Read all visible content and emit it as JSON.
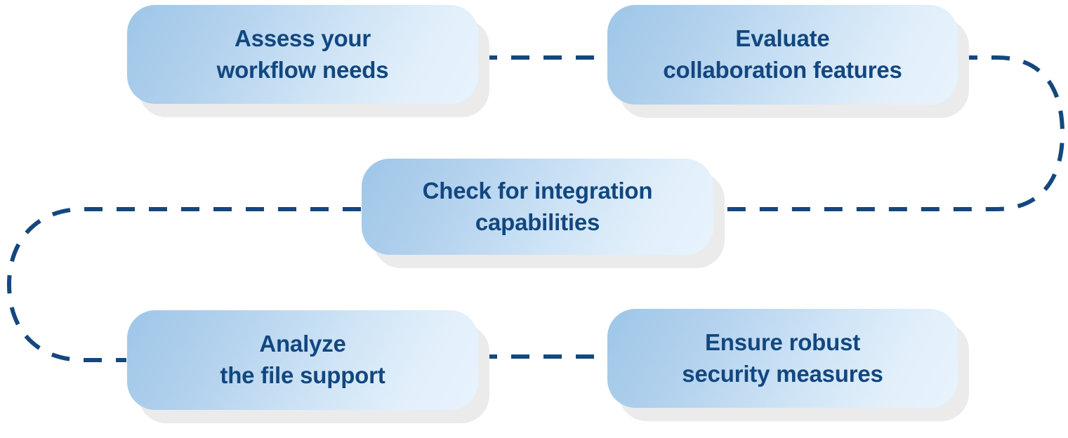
{
  "diagram": {
    "type": "flowchart",
    "title": "",
    "orientation": "serpentine",
    "palette": {
      "background": "#ffffff",
      "node_gradient_start": "#9ec6e8",
      "node_gradient_end": "#e7f2fc",
      "node_shadow": "#ebebeb",
      "text": "#12477f",
      "connector": "#14477e"
    },
    "connector_style": {
      "stroke": "#14477e",
      "width": 6,
      "dash": "26 20",
      "linecap": "butt"
    },
    "nodes": [
      {
        "id": "assess",
        "label": "Assess your\nworkflow needs",
        "order": 1,
        "row": 1,
        "column": "left"
      },
      {
        "id": "evaluate",
        "label": "Evaluate\ncollaboration features",
        "order": 2,
        "row": 1,
        "column": "right"
      },
      {
        "id": "check",
        "label": "Check for integration\ncapabilities",
        "order": 3,
        "row": 2,
        "column": "center"
      },
      {
        "id": "analyze",
        "label": "Analyze\nthe file support",
        "order": 4,
        "row": 3,
        "column": "left"
      },
      {
        "id": "ensure",
        "label": "Ensure robust\nsecurity measures",
        "order": 5,
        "row": 3,
        "column": "right"
      }
    ],
    "connections": [
      {
        "id": "c1",
        "from": "assess",
        "to": "evaluate",
        "shape": "straight-horizontal"
      },
      {
        "id": "c2",
        "from": "evaluate",
        "to": "check",
        "shape": "right-u-turn"
      },
      {
        "id": "c3",
        "from": "check",
        "to": "analyze",
        "shape": "left-u-turn"
      },
      {
        "id": "c4",
        "from": "analyze",
        "to": "ensure",
        "shape": "straight-horizontal"
      }
    ]
  }
}
